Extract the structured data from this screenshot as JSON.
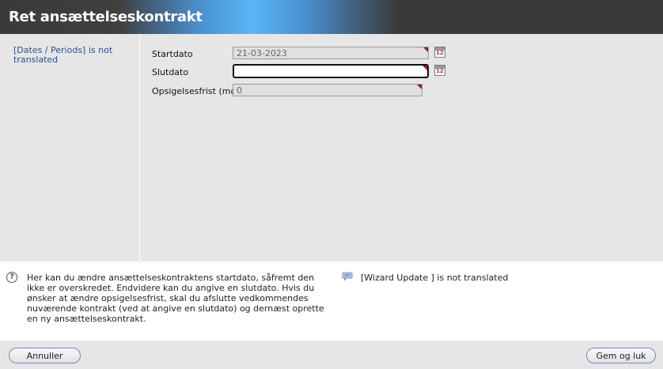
{
  "window": {
    "title": "Ret ansættelseskontrakt"
  },
  "left_panel": {
    "nav_text": "[Dates / Periods] is not translated"
  },
  "form": {
    "start_label": "Startdato",
    "start_value": "21-03-2023",
    "end_label": "Slutdato",
    "end_value": "",
    "notice_label": "Opsigelsesfrist (mdr.)",
    "notice_value": "0",
    "calendar_icon_text": "12"
  },
  "info": {
    "help_icon_glyph": "?",
    "help_text": "Her kan du ændre ansættelseskontraktens startdato, såfremt den ikke er overskredet. Endvidere kan du angive en slutdato. Hvis du ønsker at ændre opsigelsesfrist, skal du afslutte vedkommendes nuværende kontrakt (ved at angive en slutdato) og dernæst oprette en ny ansættelseskontrakt.",
    "wizard_text": "[Wizard Update ] is not translated"
  },
  "footer": {
    "cancel_label": "Annuller",
    "save_label": "Gem og luk"
  },
  "colors": {
    "required_marker": "#9b1a1a",
    "nav_link": "#2d4f8e",
    "button_border": "#6a8fbf"
  }
}
